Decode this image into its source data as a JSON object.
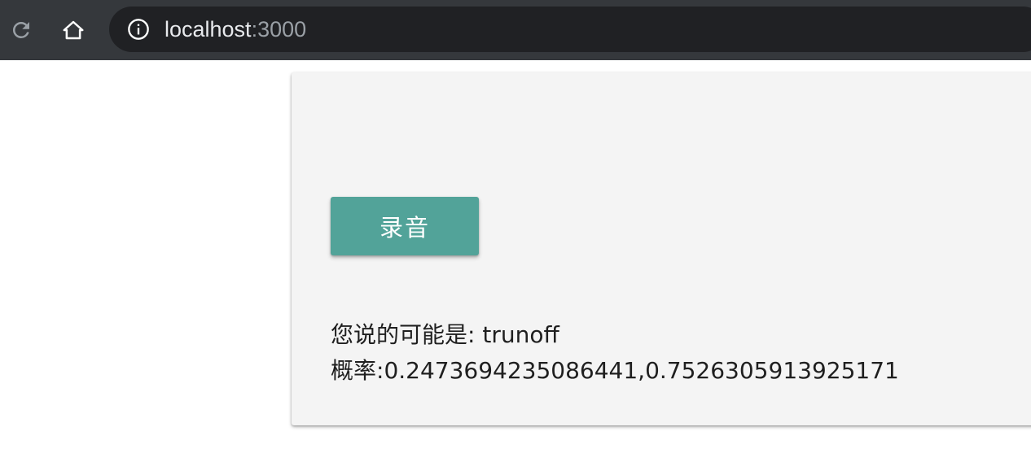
{
  "browser": {
    "icons": [
      "reload-icon",
      "home-icon",
      "info-icon"
    ],
    "url_host": "localhost",
    "url_port": ":3000"
  },
  "main": {
    "record_button_label": "录音",
    "prediction_label": "您说的可能是: ",
    "prediction_value": "trunoff",
    "probability_label": "概率:",
    "probability_value": "0.2473694235086441,0.7526305913925171"
  },
  "colors": {
    "toolbar_bg": "#35383c",
    "omnibox_bg": "#202124",
    "button_teal": "#52a399",
    "card_bg": "#f4f4f4"
  }
}
